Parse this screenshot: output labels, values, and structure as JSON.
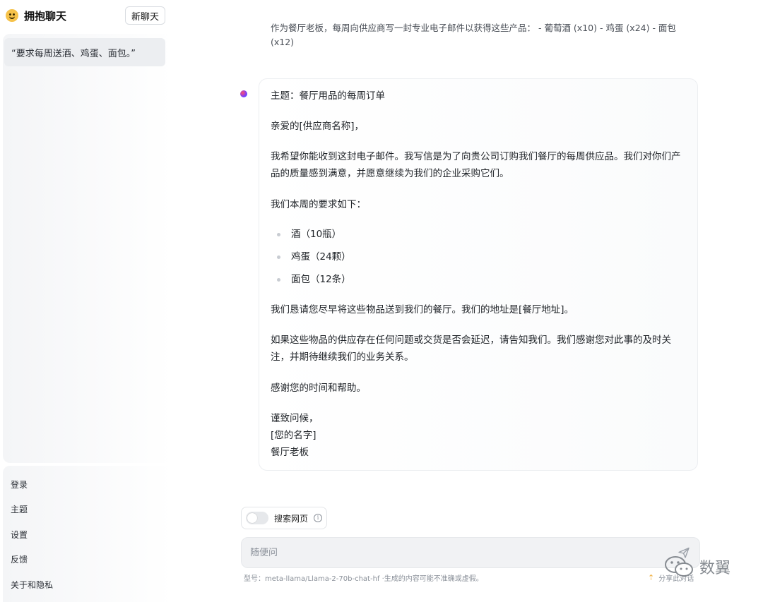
{
  "sidebar": {
    "brand": "拥抱聊天",
    "new_chat": "新聊天",
    "history": [
      {
        "title": "“要求每周送酒、鸡蛋、面包。”"
      }
    ],
    "bottom_links": [
      "登录",
      "主题",
      "设置",
      "反馈",
      "关于和隐私"
    ]
  },
  "conversation": {
    "user_message": "作为餐厅老板，每周向供应商写一封专业电子邮件以获得这些产品：  - 葡萄酒 (x10) - 鸡蛋 (x24) - 面包 (x12)",
    "assistant": {
      "subject": "主题：餐厅用品的每周订单",
      "greeting": "亲爱的[供应商名称]，",
      "para1": "我希望你能收到这封电子邮件。我写信是为了向贵公司订购我们餐厅的每周供应品。我们对你们产品的质量感到满意，并愿意继续为我们的企业采购它们。",
      "para2": "我们本周的要求如下：",
      "items": [
        "酒（10瓶）",
        "鸡蛋（24颗）",
        "面包（12条）"
      ],
      "para3": "我们恳请您尽早将这些物品送到我们的餐厅。我们的地址是[餐厅地址]。",
      "para4": "如果这些物品的供应存在任何问题或交货是否会延迟，请告知我们。我们感谢您对此事的及时关注，并期待继续我们的业务关系。",
      "para5": "感谢您的时间和帮助。",
      "closing1": "谨致问候，",
      "closing2": "[您的名字]",
      "closing3": "餐厅老板"
    }
  },
  "composer": {
    "web_search_label": "搜索网页",
    "web_search_enabled": false,
    "placeholder": "随便问",
    "model_note": "型号：meta-llama/Llama-2-70b-chat-hf ·生成的内容可能不准确或虚假。",
    "share_label": "分享此对话"
  },
  "watermark": {
    "text": "数翼",
    "icon": "wechat-icon"
  }
}
